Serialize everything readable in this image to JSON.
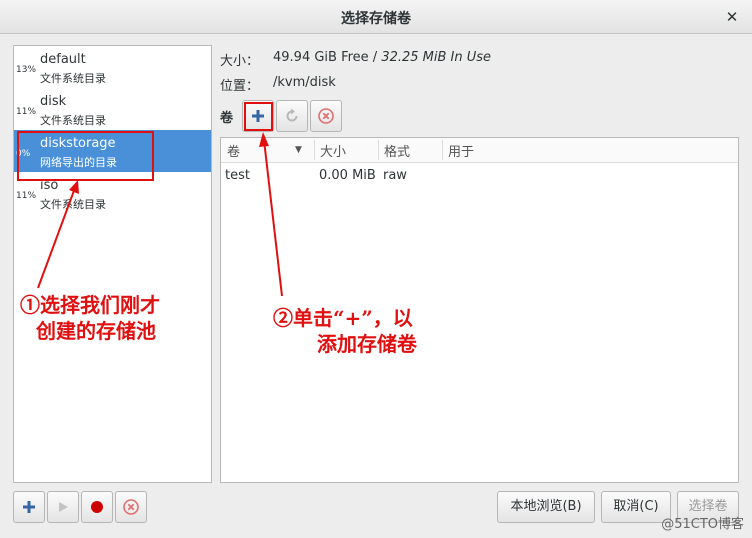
{
  "window": {
    "title": "选择存储卷",
    "close_glyph": "✕"
  },
  "pools": [
    {
      "percent": "13%",
      "name": "default",
      "type": "文件系统目录",
      "selected": false
    },
    {
      "percent": "11%",
      "name": "disk",
      "type": "文件系统目录",
      "selected": false
    },
    {
      "percent": "0%",
      "name": "diskstorage",
      "type": "网络导出的目录",
      "selected": true
    },
    {
      "percent": "11%",
      "name": "iso",
      "type": "文件系统目录",
      "selected": false
    }
  ],
  "info": {
    "size_label": "大小：",
    "size_free": "49.94 GiB Free",
    "size_sep": " / ",
    "size_used": "32.25 MiB In Use",
    "location_label": "位置：",
    "location_value": "/kvm/disk"
  },
  "volumes": {
    "label": "卷",
    "columns": [
      "卷",
      "大小",
      "格式",
      "用于"
    ],
    "sort_glyph": "▼",
    "rows": [
      {
        "name": "test",
        "size": "0.00 MiB",
        "format": "raw",
        "used_by": ""
      }
    ]
  },
  "buttons": {
    "browse_local": "本地浏览(B)",
    "cancel": "取消(C)",
    "choose_volume": "选择卷"
  },
  "annotations": {
    "note1_line1": "①选择我们刚才",
    "note1_line2": "创建的存储池",
    "note2_line1": "②单击“+”，以",
    "note2_line2": "添加存储卷"
  },
  "watermark": "@51CTO博客",
  "colors": {
    "selection": "#4a90d9",
    "annotation": "#e01010",
    "accent_blue": "#3465a4",
    "delete_red": "#cc0000"
  }
}
